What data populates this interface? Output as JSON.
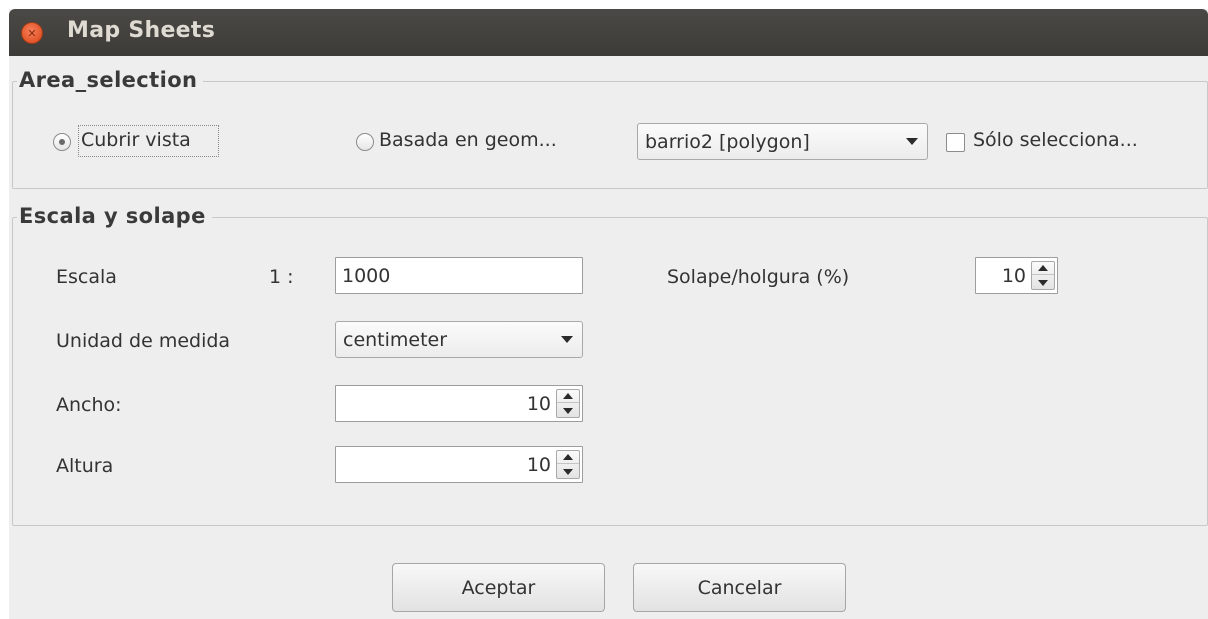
{
  "window": {
    "title": "Map Sheets"
  },
  "area_selection": {
    "legend": "Area_selection",
    "option_cover_view": "Cubrir vista",
    "option_geometry": "Basada en geom...",
    "layer_combo_value": "barrio2 [polygon]",
    "only_selected_label": "Sólo selecciona...",
    "selected_option": "Cubrir vista",
    "only_selected_checked": false
  },
  "scale_overlap": {
    "legend": "Escala y solape",
    "scale_label": "Escala",
    "scale_prefix": "1 :",
    "scale_value": "1000",
    "overlap_label": "Solape/holgura (%)",
    "overlap_value": "10",
    "unit_label": "Unidad de medida",
    "unit_value": "centimeter",
    "width_label": "Ancho:",
    "width_value": "10",
    "height_label": "Altura",
    "height_value": "10"
  },
  "buttons": {
    "accept": "Aceptar",
    "cancel": "Cancelar"
  },
  "colors": {
    "titlebar": "#3c3b37",
    "close_button": "#e1552a",
    "dialog_background": "#eeeeee"
  },
  "icons": {
    "close": "close-icon",
    "combo_arrow": "chevron-down-icon",
    "spin_up": "arrow-up-icon",
    "spin_down": "arrow-down-icon"
  }
}
